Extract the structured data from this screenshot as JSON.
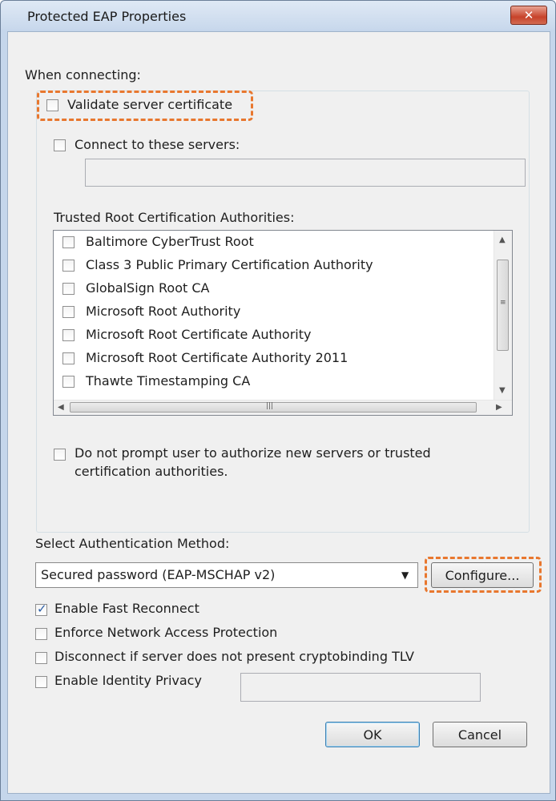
{
  "window": {
    "title": "Protected EAP Properties",
    "close_glyph": "✕"
  },
  "connecting": {
    "heading": "When connecting:",
    "validate_cert": {
      "label": "Validate server certificate",
      "checked": false
    },
    "connect_servers": {
      "label": "Connect to these servers:",
      "checked": false,
      "value": ""
    },
    "trusted_root_label": "Trusted Root Certification Authorities:",
    "authorities": [
      {
        "label": "Baltimore CyberTrust Root",
        "checked": false
      },
      {
        "label": "Class 3 Public Primary Certification Authority",
        "checked": false
      },
      {
        "label": "GlobalSign Root CA",
        "checked": false
      },
      {
        "label": "Microsoft Root Authority",
        "checked": false
      },
      {
        "label": "Microsoft Root Certificate Authority",
        "checked": false
      },
      {
        "label": "Microsoft Root Certificate Authority 2011",
        "checked": false
      },
      {
        "label": "Thawte Timestamping CA",
        "checked": false
      }
    ],
    "no_prompt": {
      "label_line1": "Do not prompt user to authorize new servers or trusted",
      "label_line2": "certification authorities.",
      "checked": false
    }
  },
  "auth": {
    "heading": "Select Authentication Method:",
    "method_value": "Secured password (EAP-MSCHAP v2)",
    "configure_label": "Configure..."
  },
  "options": {
    "fast_reconnect": {
      "label": "Enable Fast Reconnect",
      "checked": true
    },
    "nap": {
      "label": "Enforce Network Access Protection",
      "checked": false
    },
    "cryptobinding": {
      "label": "Disconnect if server does not present cryptobinding TLV",
      "checked": false
    },
    "identity_privacy": {
      "label": "Enable Identity Privacy",
      "checked": false,
      "value": ""
    }
  },
  "buttons": {
    "ok": "OK",
    "cancel": "Cancel"
  },
  "colors": {
    "highlight": "#e8772e",
    "window_frame": "#c5d6eb",
    "close": "#c7432a"
  },
  "icons": {
    "close": "close-icon",
    "scroll_up": "scroll-up-icon",
    "scroll_down": "scroll-down-icon",
    "scroll_left": "scroll-left-icon",
    "scroll_right": "scroll-right-icon",
    "dropdown": "chevron-down-icon"
  }
}
